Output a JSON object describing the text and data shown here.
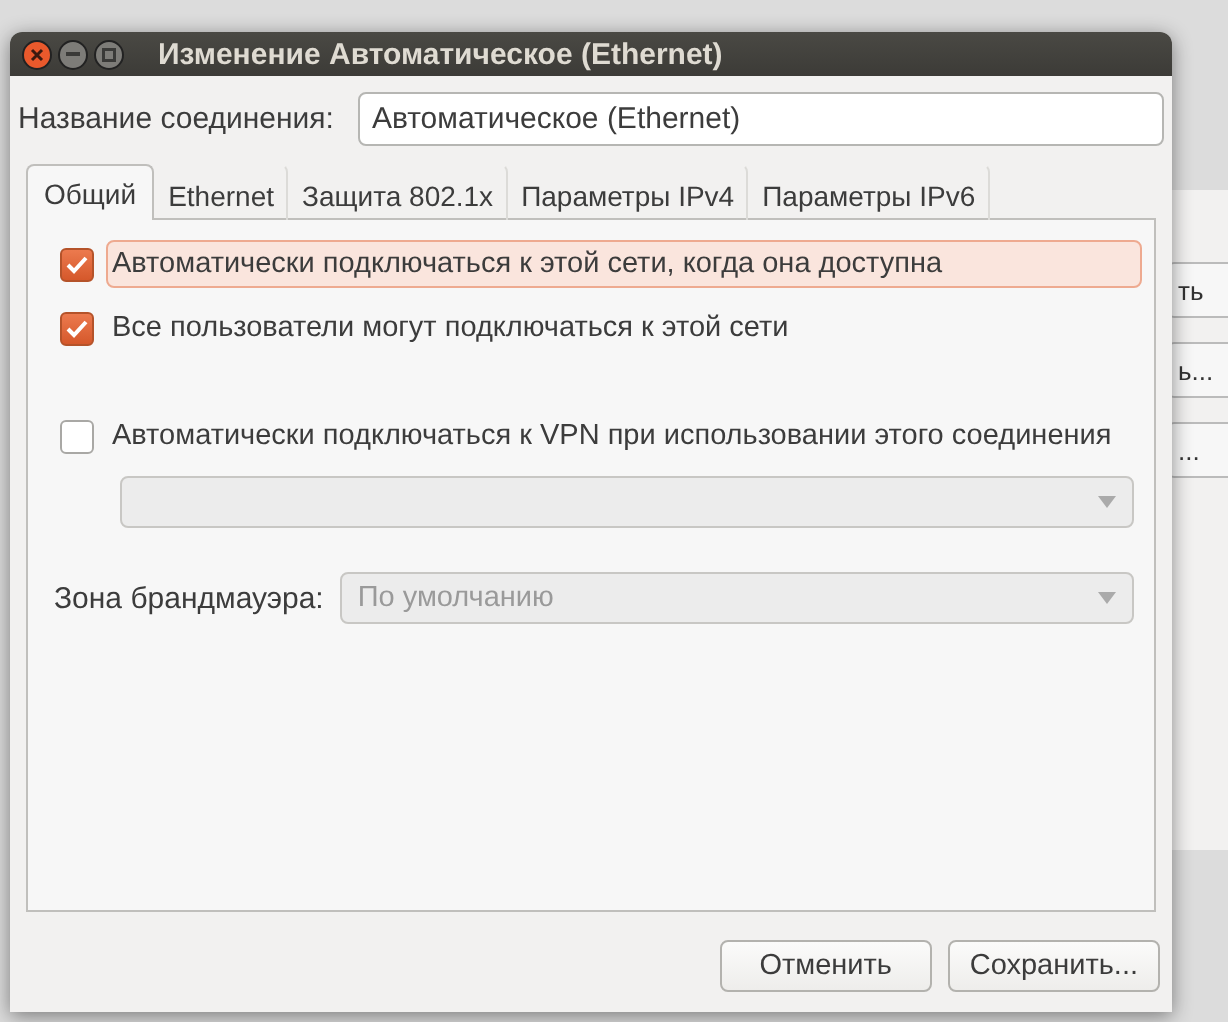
{
  "background_window": {
    "buttons": [
      "ть",
      "ь...",
      "..."
    ]
  },
  "window": {
    "title": "Изменение Автоматическое (Ethernet)"
  },
  "connection_name": {
    "label": "Название соединения:",
    "value": "Автоматическое (Ethernet)"
  },
  "tabs": [
    {
      "label": "Общий",
      "selected": true
    },
    {
      "label": "Ethernet",
      "selected": false
    },
    {
      "label": "Защита 802.1x",
      "selected": false
    },
    {
      "label": "Параметры IPv4",
      "selected": false
    },
    {
      "label": "Параметры IPv6",
      "selected": false
    }
  ],
  "options": [
    {
      "label": "Автоматически подключаться к этой сети, когда она доступна",
      "checked": true,
      "focused": true
    },
    {
      "label": "Все пользователи могут подключаться к этой сети",
      "checked": true,
      "focused": false
    },
    {
      "label": "Автоматически подключаться к VPN при использовании этого соединения",
      "checked": false,
      "focused": false
    }
  ],
  "vpn_select": {
    "disabled": true
  },
  "firewall_zone": {
    "label": "Зона брандмауэра:",
    "value": "По умолчанию",
    "disabled": true
  },
  "buttons": [
    "Отменить",
    "Сохранить..."
  ]
}
